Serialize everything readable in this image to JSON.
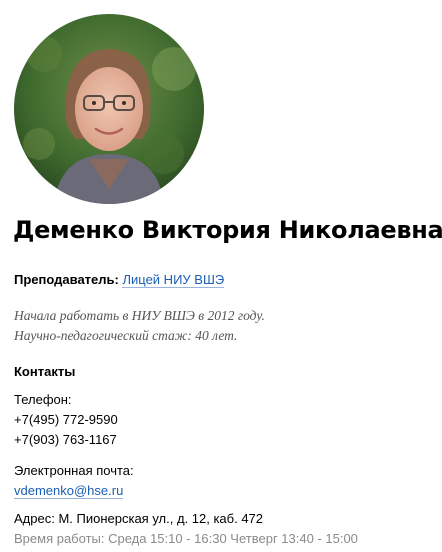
{
  "profile": {
    "name": "Деменко Виктория Николаевна",
    "position_label": "Преподаватель:",
    "position_link": "Лицей НИУ ВШЭ",
    "bio": [
      "Начала работать в НИУ ВШЭ в 2012 году.",
      "Научно-педагогический стаж: 40 лет."
    ]
  },
  "contacts": {
    "heading": "Контакты",
    "phone_label": "Телефон:",
    "phones": [
      "+7(495) 772-9590",
      "+7(903) 763-1167"
    ],
    "email_label": "Электронная почта:",
    "email": "vdemenko@hse.ru",
    "address": "Адрес: М. Пионерская ул., д. 12, каб. 472",
    "hours": "Время работы: Среда 15:10 - 16:30 Четверг 13:40 - 15:00"
  },
  "colors": {
    "link": "#1a5fb4",
    "muted": "#8a8a8a",
    "bio": "#555555"
  }
}
